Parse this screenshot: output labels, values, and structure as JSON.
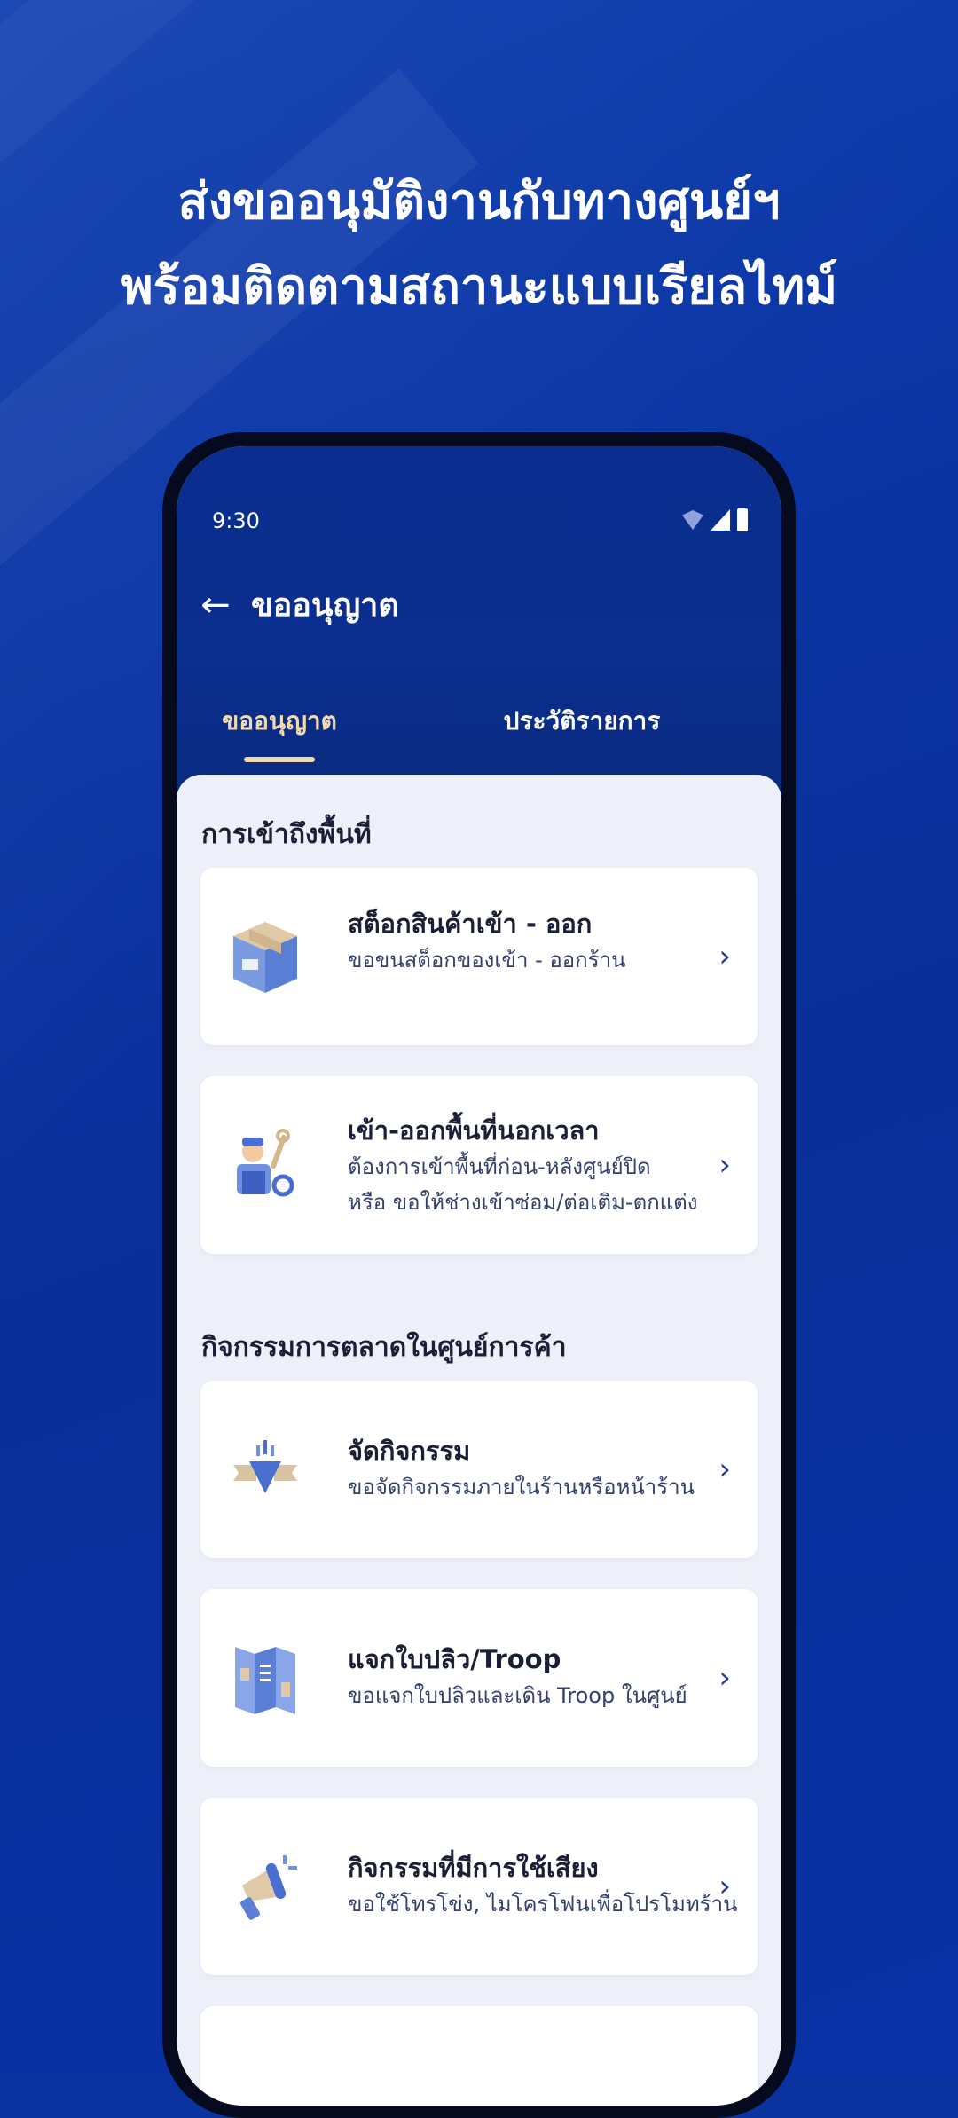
{
  "headline": {
    "line1": "ส่งขออนุมัติงานกับทางศูนย์ฯ",
    "line2": "พร้อมติดตามสถานะแบบเรียลไทม์"
  },
  "status_bar": {
    "time": "9:30"
  },
  "app_bar": {
    "back_icon": "arrow-left-icon",
    "title": "ขออนุญาต"
  },
  "tabs": [
    {
      "label": "ขออนุญาต",
      "active": true
    },
    {
      "label": "ประวัติรายการ",
      "active": false
    }
  ],
  "sections": [
    {
      "title": "การเข้าถึงพื้นที่",
      "items": [
        {
          "icon": "box-icon",
          "title": "สต็อกสินค้าเข้า - ออก",
          "desc_lines": [
            "ขอขนสต็อกของเข้า - ออกร้าน"
          ]
        },
        {
          "icon": "technician-icon",
          "title": "เข้า-ออกพื้นที่นอกเวลา",
          "desc_lines": [
            "ต้องการเข้าพื้นที่ก่อน-หลังศูนย์ปิด",
            "หรือ ขอให้ช่างเข้าซ่อม/ต่อเติม-ตกแต่ง"
          ]
        }
      ]
    },
    {
      "title": "กิจกรรมการตลาดในศูนย์การค้า",
      "items": [
        {
          "icon": "event-icon",
          "title": "จัดกิจกรรม",
          "desc_lines": [
            "ขอจัดกิจกรรมภายในร้านหรือหน้าร้าน"
          ]
        },
        {
          "icon": "brochure-icon",
          "title": "แจกใบปลิว/Troop",
          "desc_lines": [
            "ขอแจกใบปลิวและเดิน Troop ในศูนย์"
          ]
        },
        {
          "icon": "megaphone-icon",
          "title": "กิจกรรมที่มีการใช้เสียง",
          "desc_lines": [
            "ขอใช้โทรโข่ง, ไมโครโฟนเพื่อโปรโมทร้าน"
          ]
        }
      ]
    }
  ],
  "colors": {
    "background": "#0a33a0",
    "accent_tab": "#f3d9b1",
    "card_bg": "#ffffff",
    "content_bg": "#eef0f9"
  }
}
